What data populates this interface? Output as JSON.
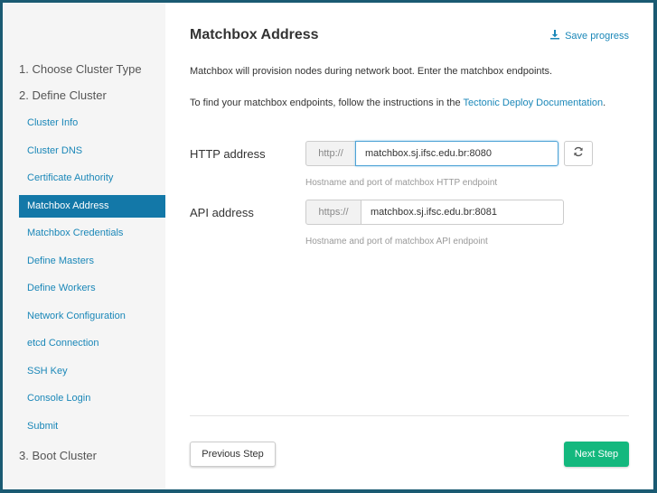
{
  "sidebar": {
    "steps": [
      {
        "label": "1. Choose Cluster Type"
      },
      {
        "label": "2. Define Cluster"
      },
      {
        "label": "3. Boot Cluster"
      }
    ],
    "items": [
      {
        "label": "Cluster Info"
      },
      {
        "label": "Cluster DNS"
      },
      {
        "label": "Certificate Authority"
      },
      {
        "label": "Matchbox Address",
        "active": true
      },
      {
        "label": "Matchbox Credentials"
      },
      {
        "label": "Define Masters"
      },
      {
        "label": "Define Workers"
      },
      {
        "label": "Network Configuration"
      },
      {
        "label": "etcd Connection"
      },
      {
        "label": "SSH Key"
      },
      {
        "label": "Console Login"
      },
      {
        "label": "Submit"
      }
    ]
  },
  "main": {
    "title": "Matchbox Address",
    "save_progress": "Save progress",
    "intro": "Matchbox will provision nodes during network boot. Enter the matchbox endpoints.",
    "instructions_prefix": "To find your matchbox endpoints, follow the instructions in the ",
    "instructions_link": "Tectonic Deploy Documentation",
    "instructions_suffix": ".",
    "http": {
      "label": "HTTP address",
      "prefix": "http://",
      "value": "matchbox.sj.ifsc.edu.br:8080",
      "help": "Hostname and port of matchbox HTTP endpoint"
    },
    "api": {
      "label": "API address",
      "prefix": "https://",
      "value": "matchbox.sj.ifsc.edu.br:8081",
      "help": "Hostname and port of matchbox API endpoint"
    },
    "prev_button": "Previous Step",
    "next_button": "Next Step"
  },
  "colors": {
    "accent": "#1378a8",
    "link": "#1a87b8",
    "primary_button": "#14b87e"
  }
}
